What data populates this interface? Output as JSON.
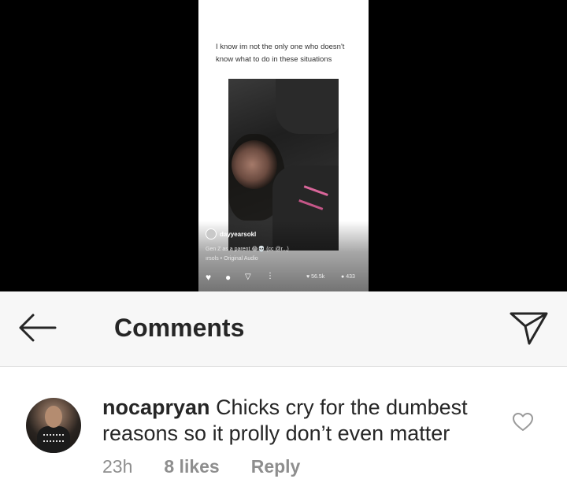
{
  "post": {
    "caption": "I know im not the only one who doesn't know what to do in these situations",
    "video": {
      "poster_name": "dayyearsokl",
      "caption": "Gen Z as a parent 😂💀 (cc @r...)",
      "audio": "ırsols • Original Audio",
      "likes": "56.5k",
      "comments": "433"
    }
  },
  "header": {
    "title": "Comments"
  },
  "comment": {
    "username": "nocapryan",
    "text": "Chicks cry for the dumbest reasons so it prolly don’t even matter",
    "time": "23h",
    "likes": "8 likes",
    "reply_label": "Reply"
  },
  "icons": {
    "back": "back-arrow-icon",
    "share": "paper-plane-icon",
    "like": "heart-outline-icon"
  },
  "colors": {
    "text": "#262626",
    "muted": "#8e8e8e",
    "header_bg": "#f7f7f7"
  }
}
